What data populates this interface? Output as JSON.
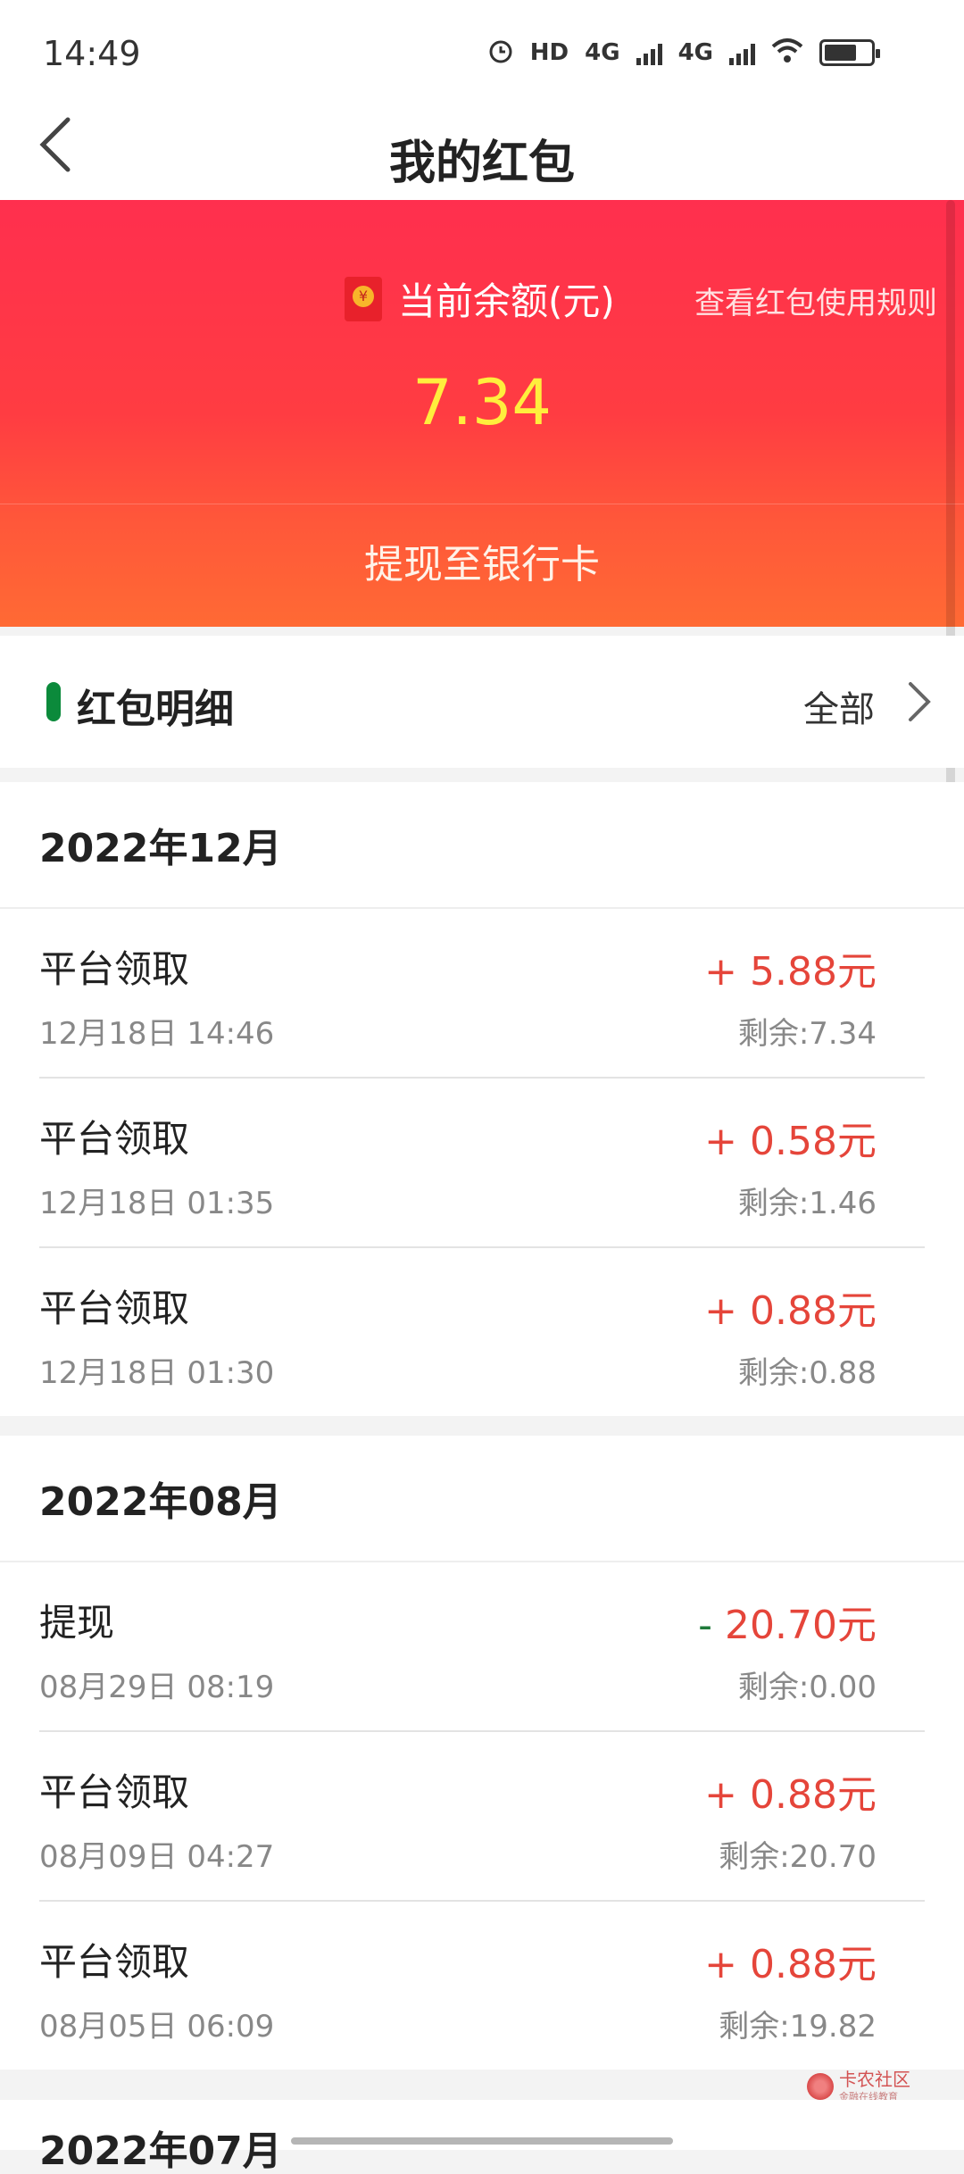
{
  "status_bar": {
    "time": "14:49",
    "icons": [
      "alarm-icon",
      "hd-icon",
      "4g-signal-icon",
      "4g-signal-icon",
      "wifi-icon",
      "battery-icon"
    ],
    "hd_label": "HD",
    "net_label": "4G"
  },
  "nav": {
    "title": "我的红包",
    "back_icon": "chevron-left-icon"
  },
  "balance": {
    "label": "当前余额(元)",
    "value": "7.34",
    "rules_link": "查看红包使用规则",
    "withdraw_label": "提现至银行卡"
  },
  "details": {
    "title": "红包明细",
    "filter_label": "全部"
  },
  "months": [
    {
      "title": "2022年12月",
      "records": [
        {
          "title": "平台领取",
          "time": "12月18日 14:46",
          "sign": "+",
          "amount": "5.88元",
          "remain": "剩余:7.34"
        },
        {
          "title": "平台领取",
          "time": "12月18日 01:35",
          "sign": "+",
          "amount": "0.58元",
          "remain": "剩余:1.46"
        },
        {
          "title": "平台领取",
          "time": "12月18日 01:30",
          "sign": "+",
          "amount": "0.88元",
          "remain": "剩余:0.88"
        }
      ]
    },
    {
      "title": "2022年08月",
      "records": [
        {
          "title": "提现",
          "time": "08月29日 08:19",
          "sign": "-",
          "amount": "20.70元",
          "remain": "剩余:0.00"
        },
        {
          "title": "平台领取",
          "time": "08月09日 04:27",
          "sign": "+",
          "amount": "0.88元",
          "remain": "剩余:20.70"
        },
        {
          "title": "平台领取",
          "time": "08月05日 06:09",
          "sign": "+",
          "amount": "0.88元",
          "remain": "剩余:19.82"
        }
      ]
    },
    {
      "title": "2022年07月",
      "records": []
    }
  ],
  "watermark": {
    "name": "卡农社区",
    "sub": "金融在线教育"
  },
  "colors": {
    "banner_top": "#ff2f4e",
    "banner_bottom": "#ff6a34",
    "balance_value": "#ffee3d",
    "income": "#e5453a",
    "expense_sign": "#1f7a3a",
    "marker": "#0b8a3b"
  }
}
